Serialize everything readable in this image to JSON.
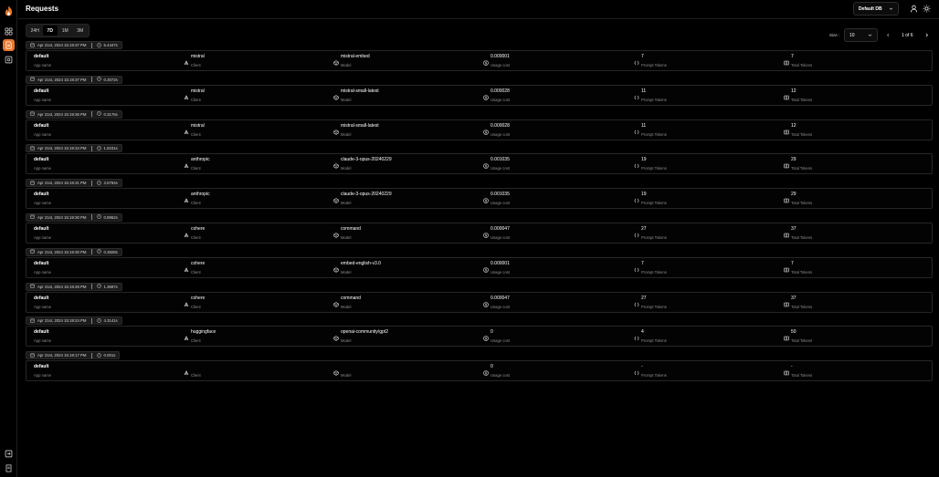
{
  "header": {
    "title": "Requests",
    "db_select": "Default DB"
  },
  "toolbar": {
    "ranges": [
      "24H",
      "7D",
      "1M",
      "3M"
    ],
    "active_range": "7D",
    "size_label": "Size :",
    "size_value": "10",
    "page_info": "1 of 6"
  },
  "labels": {
    "app_name": "App name",
    "client": "Client",
    "model": "Model",
    "usage_cost": "Usage cost",
    "prompt_tokens": "Prompt Tokens",
    "total_tokens": "Total Tokens"
  },
  "colors": {
    "accent": "#e8762b",
    "background": "#000000",
    "border": "#262626",
    "muted": "#8d8d8d"
  },
  "requests": [
    {
      "timestamp": "Apr 21st, 2024 15:19:37 PM",
      "duration": "5.4447s",
      "app": "default",
      "client": "mistral",
      "model": "mistral-embed",
      "cost": "0.000001",
      "prompt_tokens": "7",
      "total_tokens": "7"
    },
    {
      "timestamp": "Apr 21st, 2024 15:19:37 PM",
      "duration": "0.3072s",
      "app": "default",
      "client": "mistral",
      "model": "mistral-small-latest",
      "cost": "0.000028",
      "prompt_tokens": "11",
      "total_tokens": "12"
    },
    {
      "timestamp": "Apr 21st, 2024 15:19:36 PM",
      "duration": "0.3176s",
      "app": "default",
      "client": "mistral",
      "model": "mistral-small-latest",
      "cost": "0.000028",
      "prompt_tokens": "11",
      "total_tokens": "12"
    },
    {
      "timestamp": "Apr 21st, 2024 15:19:34 PM",
      "duration": "1.8231s",
      "app": "default",
      "client": "anthropic",
      "model": "claude-3-opus-20240229",
      "cost": "0.001035",
      "prompt_tokens": "19",
      "total_tokens": "29"
    },
    {
      "timestamp": "Apr 21st, 2024 15:19:31 PM",
      "duration": "3.5794s",
      "app": "default",
      "client": "anthropic",
      "model": "claude-3-opus-20240229",
      "cost": "0.001035",
      "prompt_tokens": "19",
      "total_tokens": "29"
    },
    {
      "timestamp": "Apr 21st, 2024 15:19:30 PM",
      "duration": "0.8962s",
      "app": "default",
      "client": "cohere",
      "model": "command",
      "cost": "0.000047",
      "prompt_tokens": "27",
      "total_tokens": "37"
    },
    {
      "timestamp": "Apr 21st, 2024 15:19:30 PM",
      "duration": "0.3828s",
      "app": "default",
      "client": "cohere",
      "model": "embed-english-v3.0",
      "cost": "0.000001",
      "prompt_tokens": "7",
      "total_tokens": "7"
    },
    {
      "timestamp": "Apr 21st, 2024 15:19:28 PM",
      "duration": "1.3687s",
      "app": "default",
      "client": "cohere",
      "model": "command",
      "cost": "0.000047",
      "prompt_tokens": "27",
      "total_tokens": "37"
    },
    {
      "timestamp": "Apr 21st, 2024 15:19:24 PM",
      "duration": "4.3141s",
      "app": "default",
      "client": "huggingface",
      "model": "openai-community/gpt2",
      "cost": "0",
      "prompt_tokens": "4",
      "total_tokens": "50"
    },
    {
      "timestamp": "Apr 21st, 2024 15:19:17 PM",
      "duration": "0.001s",
      "app": "default",
      "client": "",
      "model": "",
      "cost": "0",
      "prompt_tokens": "-",
      "total_tokens": "-"
    }
  ]
}
